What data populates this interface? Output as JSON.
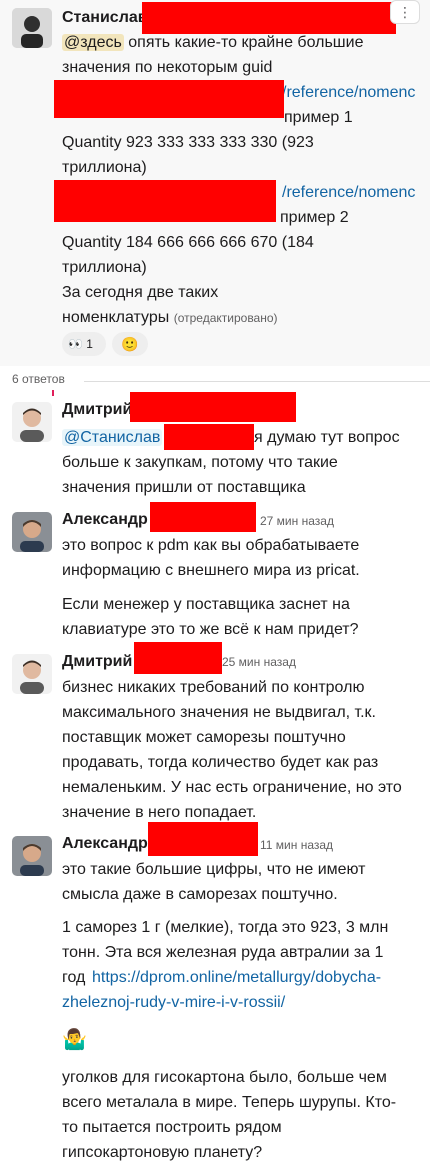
{
  "parent": {
    "author": "Станислав",
    "more_label": "⋮",
    "mention": "@здесь",
    "lines": [
      "опять какие-то крайне большие",
      "значения по некоторым guid",
      "/reference/nomenc",
      "пример 1",
      "Quantity 923 333 333 333 330 (923",
      "триллиона)",
      "/reference/nomenc",
      "пример 2",
      "Quantity 184 666 666 666 670 (184",
      "триллиона)",
      "За сегодня две таких",
      "номенклатуры"
    ],
    "edited": "(отредактировано)",
    "reaction": {
      "emoji": "👀",
      "count": "1"
    },
    "add_reaction_icon": "🙂"
  },
  "thread": {
    "replies_count": "6 ответов"
  },
  "replies": [
    {
      "author": "Дмитрий",
      "time": "",
      "mention": "@Станислав",
      "lines": [
        "я думаю тут вопрос",
        "больше к закупкам, потому что такие",
        "значения пришли от поставщика"
      ]
    },
    {
      "author": "Александр",
      "time": "27 мин назад",
      "lines": [
        "это вопрос к pdm как вы обрабатываете",
        "информацию с внешнего мира из pricat.",
        "Если менежер у поставщика заснет на",
        "клавиатуре это то же всё к нам придет?"
      ]
    },
    {
      "author": "Дмитрий",
      "time": "25 мин назад",
      "lines": [
        "бизнес никаких требований по контролю",
        "максимального значения не выдвигал, т.к.",
        "поставщик может саморезы поштучно",
        "продавать, тогда количество будет как раз",
        "немаленьким. У нас есть ограничение, но это",
        "значение в него попадает."
      ]
    },
    {
      "author": "Александр",
      "time": "11 мин назад",
      "lines": [
        "это такие большие цифры, что не имеют",
        "смысла даже в саморезах поштучно.",
        "1 саморез 1 г (мелкие), тогда это 923, 3 млн",
        "тонн.  Эта вся железная руда автралии за 1",
        "год",
        "https://dprom.online/metallurgy/dobycha-",
        "zheleznoj-rudy-v-mire-i-v-rossii/",
        "🤷‍♂️",
        "уголков для гисокартона было, больше чем",
        "всего металала в мире. Теперь шурупы. Кто-",
        "то  пытается построить рядом",
        "гипсокартоновую планету?"
      ]
    }
  ]
}
